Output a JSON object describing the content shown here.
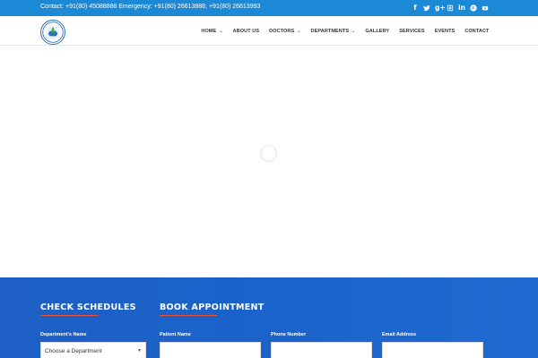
{
  "topbar": {
    "contact": "Contact: +91(80) 45088888 Emergency: +91(80) 26613888, +91(80) 26613993",
    "socials": [
      "facebook-icon",
      "twitter-icon",
      "google-plus-icon",
      "instagram-icon",
      "linkedin-icon",
      "pinterest-icon",
      "youtube-icon"
    ]
  },
  "nav": {
    "items": [
      {
        "label": "HOME",
        "dropdown": true
      },
      {
        "label": "ABOUT US",
        "dropdown": false
      },
      {
        "label": "DOCTORS",
        "dropdown": true
      },
      {
        "label": "DEPARTMENTS",
        "dropdown": true
      },
      {
        "label": "GALLERY",
        "dropdown": false
      },
      {
        "label": "SERVICES",
        "dropdown": false
      },
      {
        "label": "EVENTS",
        "dropdown": false
      },
      {
        "label": "CONTACT",
        "dropdown": false
      }
    ]
  },
  "appointment": {
    "check_title": "CHECK SCHEDULES",
    "book_title": "BOOK APPOINTMENT",
    "department_label": "Department's Name",
    "department_value": "Choose a Department",
    "patient_label": "Patient Name",
    "phone_label": "Phone Number",
    "email_label": "Email Address"
  },
  "colors": {
    "topbar": "#1b89d6",
    "band": "#1d5fc5",
    "accent_underline": "#e4533a"
  }
}
